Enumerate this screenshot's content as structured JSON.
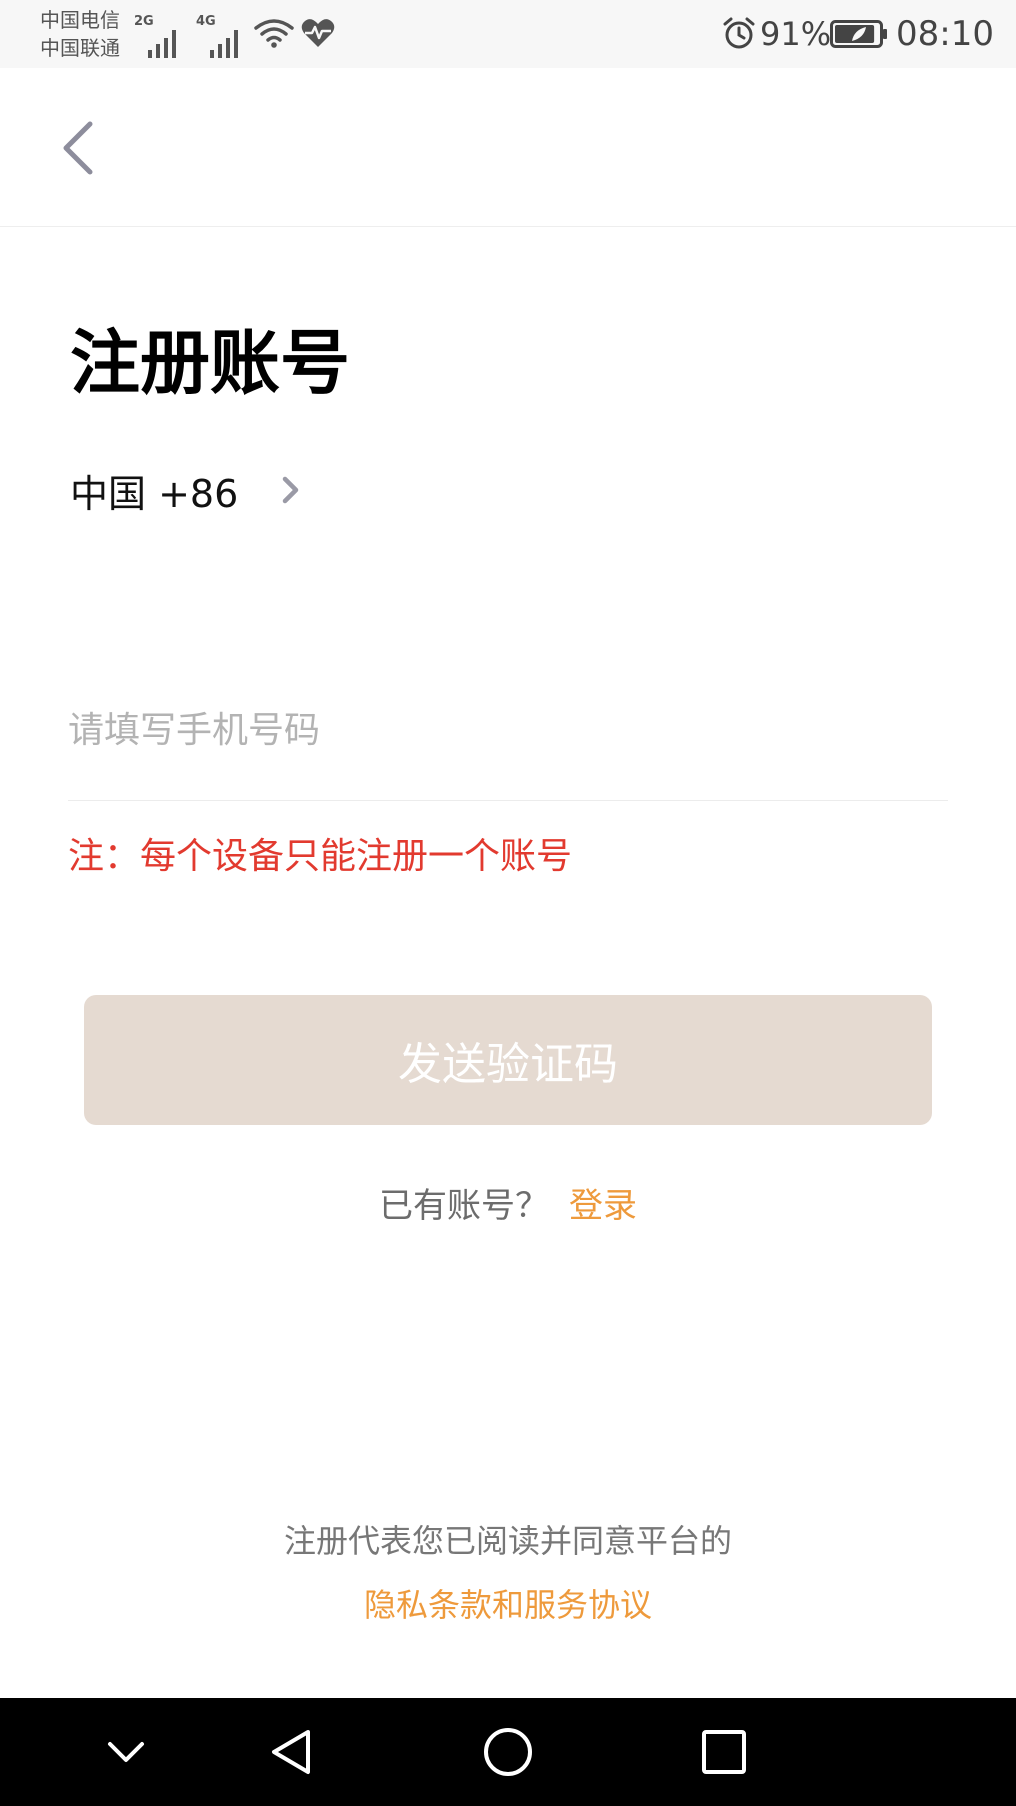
{
  "status_bar": {
    "carrier_1": "中国电信",
    "carrier_2": "中国联通",
    "signal_1_tag": "2G",
    "signal_2_tag": "4G",
    "battery_percent": "91%",
    "battery_level": 0.91,
    "time": "08:10",
    "icons": [
      "signal-icon",
      "signal-icon",
      "wifi-icon",
      "health-heart-icon",
      "alarm-icon",
      "battery-icon"
    ]
  },
  "header": {
    "back_icon": "chevron-left-icon"
  },
  "main": {
    "title": "注册账号",
    "country_code": "中国 +86",
    "country_chevron_icon": "chevron-right-icon",
    "phone_value": "",
    "phone_placeholder": "请填写手机号码",
    "notice": "注：每个设备只能注册一个账号",
    "send_code_label": "发送验证码",
    "login_prompt": "已有账号？",
    "login_link": "登录",
    "agreement_text": "注册代表您已阅读并同意平台的",
    "agreement_link": "隐私条款和服务协议"
  },
  "nav_bar": {
    "icons": [
      "chevron-down-icon",
      "back-triangle-icon",
      "home-circle-icon",
      "recents-square-icon"
    ]
  },
  "colors": {
    "accent": "#ee9a3c",
    "notice_red": "#e23a2f",
    "button_disabled_bg": "#e5dad1",
    "placeholder": "#b3b3b3",
    "nav_bar_bg": "#000000"
  }
}
